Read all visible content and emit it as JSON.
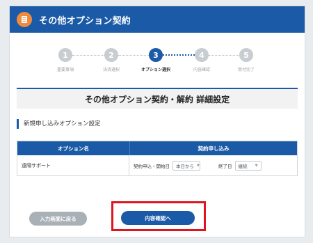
{
  "header": {
    "title": "その他オプション契約"
  },
  "steps": [
    {
      "num": "1",
      "label": "重要事項",
      "active": false
    },
    {
      "num": "2",
      "label": "決済選択",
      "active": false
    },
    {
      "num": "3",
      "label": "オプション選択",
      "active": true
    },
    {
      "num": "4",
      "label": "内容確認",
      "active": false
    },
    {
      "num": "5",
      "label": "受付完了",
      "active": false
    }
  ],
  "section": {
    "title": "その他オプション契約・解約 詳細設定"
  },
  "subhead": "新規申し込みオプション設定",
  "table": {
    "col1": "オプション名",
    "col2": "契約申し込み",
    "row": {
      "name": "遠隔サポート",
      "start_label": "契約申込・開始日",
      "start_value": "本日から",
      "end_label": "終了日",
      "end_value": "継続"
    }
  },
  "buttons": {
    "back": "入力画面に戻る",
    "confirm": "内容確認へ"
  },
  "colors": {
    "brand": "#1a5aa6",
    "accent": "#f08a3c",
    "highlight": "#e0141c"
  }
}
